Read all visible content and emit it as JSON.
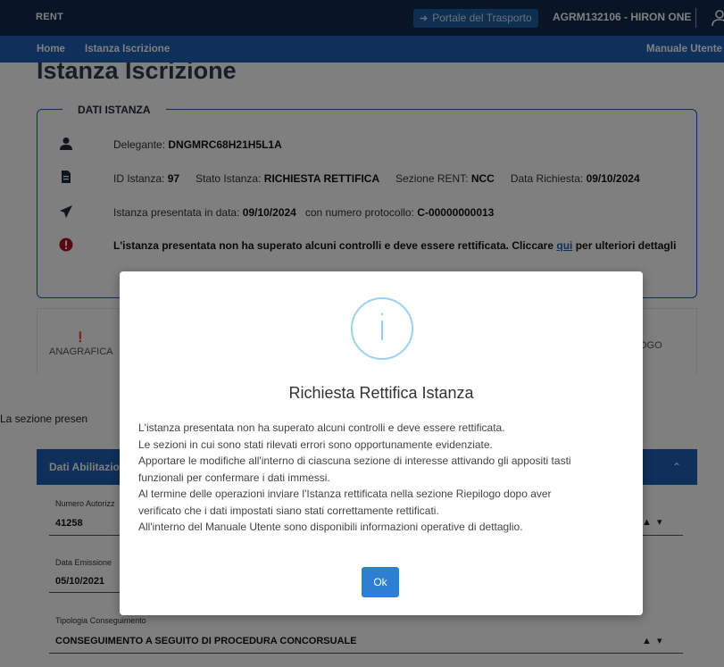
{
  "topbar": {
    "brand": "RENT",
    "portal_label": "Portale del Trasporto",
    "user_label": "AGRM132106 - HIRON ONE"
  },
  "navbar": {
    "home": "Home",
    "istanza": "Istanza Iscrizione",
    "manuale": "Manuale Utente"
  },
  "page": {
    "title": "Istanza Iscrizione"
  },
  "dati_istanza": {
    "legend": "DATI ISTANZA",
    "delegante_label": "Delegante:",
    "delegante_value": "DNGMRC68H21H5L1A",
    "id_label": "ID Istanza:",
    "id_value": "97",
    "stato_label": "Stato Istanza:",
    "stato_value": "RICHIESTA RETTIFICA",
    "sezione_label": "Sezione RENT:",
    "sezione_value": "NCC",
    "data_label": "Data Richiesta:",
    "data_value": "09/10/2024",
    "presentata_label": "Istanza presentata in data:",
    "presentata_value": "09/10/2024",
    "protocollo_label": "con numero protocollo:",
    "protocollo_value": "C-00000000013",
    "warning_text": "L'istanza presentata non ha superato alcuni controlli e deve essere rettificata. Cliccare",
    "warning_link": "qui",
    "warning_suffix": "per ulteriori dettagli"
  },
  "tabs": {
    "anagrafica": "ANAGRAFICA",
    "riepilogo_fragment": "OGO"
  },
  "section_text_fragment": "La sezione presen",
  "accordion": {
    "title_fragment": "Dati Abilitazion"
  },
  "fields": {
    "numero_label_fragment": "Numero Autorizz",
    "numero_value": "41258",
    "data_emissione_label": "Data Emissione",
    "data_emissione_value": "05/10/2021",
    "tipologia_label": "Tipologia Conseguimento",
    "tipologia_value": "CONSEGUIMENTO A SEGUITO DI PROCEDURA CONCORSUALE"
  },
  "modal": {
    "icon": "info-icon",
    "title": "Richiesta Rettifica Istanza",
    "lines": [
      "L'istanza presentata non ha superato alcuni controlli e deve essere rettificata.",
      "Le sezioni in cui sono stati rilevati errori sono opportunamente evidenziate.",
      "Apportare le modifiche all'interno di ciascuna sezione di interesse attivando gli appositi tasti",
      "funzionali per confermare i dati immessi.",
      "Al termine delle operazioni inviare l'Istanza rettificata nella sezione Riepilogo dopo aver",
      "verificato che i dati impostati siano stati correttamente rettificati.",
      "All'interno del Manuale Utente sono disponibili informazioni operative di dettaglio."
    ],
    "ok_label": "Ok"
  },
  "colors": {
    "topbar": "#0e2a4a",
    "navbar": "#1e60b5",
    "accent_button": "#2d7fd4",
    "warning": "#b01020",
    "info_circle": "#9dd3ea"
  }
}
